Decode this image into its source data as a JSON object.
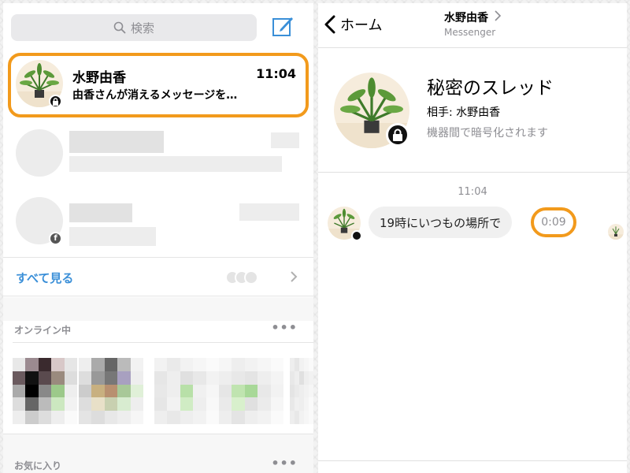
{
  "left": {
    "search": {
      "placeholder": "検索",
      "icon": "search-icon"
    },
    "compose_icon": "compose-icon",
    "chats": [
      {
        "name": "水野由香",
        "time": "11:04",
        "preview": "由香さんが消えるメッセージを…",
        "avatar": "plant-avatar",
        "badge": "lock-icon",
        "highlighted": true
      },
      {
        "name": "",
        "blurred": true
      },
      {
        "name": "",
        "blurred": true,
        "badge": "facebook-icon"
      }
    ],
    "see_all_label": "すべて見る",
    "online_header": "オンライン中",
    "favorites_header": "お気に入り"
  },
  "right": {
    "back_label": "ホーム",
    "header_title": "水野由香",
    "header_sub": "Messenger",
    "thread_title": "秘密のスレッド",
    "partner_label": "相手: 水野由香",
    "encryption_note": "機器間で暗号化されます",
    "message_time": "11:04",
    "message_text": "19時にいつもの場所で",
    "timer_label": "0:09"
  },
  "colors": {
    "highlight": "#f29a1c",
    "link_blue": "#3a8fd8",
    "muted": "#8e8e93"
  }
}
